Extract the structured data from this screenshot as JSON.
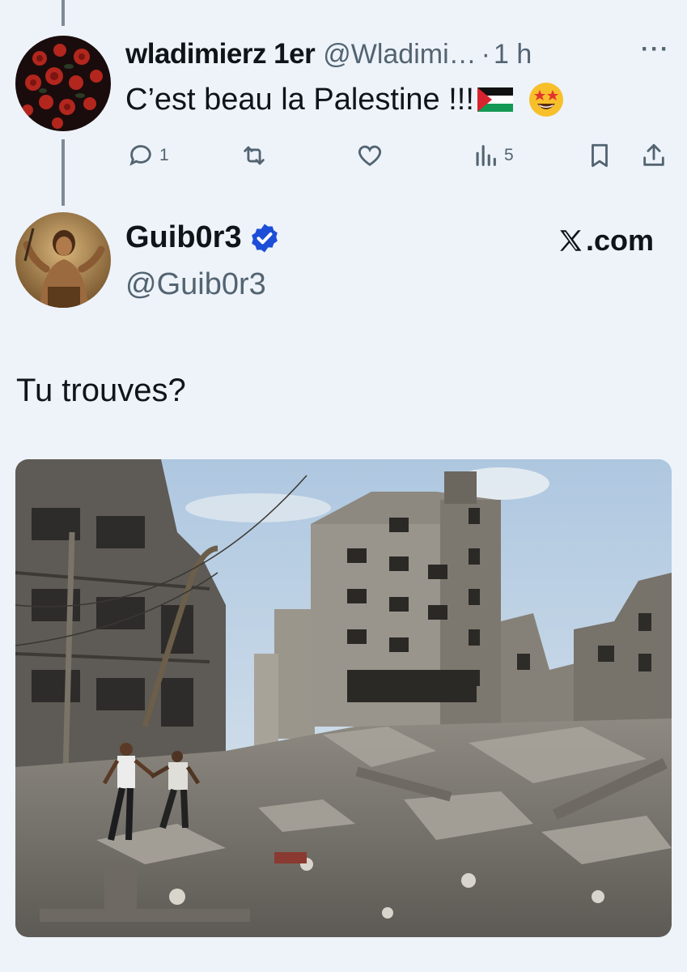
{
  "reply": {
    "display_name": "wladimierz 1er",
    "handle": "@Wladimi…",
    "separator": "·",
    "time": "1 h",
    "more_label": "···",
    "text": "C’est beau la Palestine !!!",
    "avatar_icon": "rose-avatar",
    "actions": {
      "reply_count": "1",
      "views_count": "5"
    }
  },
  "quote": {
    "display_name": "Guib0r3",
    "handle": "@Guib0r3",
    "source": ".com",
    "verified_color": "#1d4ed8",
    "text": "Tu trouves?",
    "avatar_icon": "warrior-avatar",
    "image": "ruined-street-photo"
  },
  "colors": {
    "background": "#eef3fa",
    "text": "#0f1419",
    "muted": "#536471",
    "thread_line": "#7f8a97"
  }
}
